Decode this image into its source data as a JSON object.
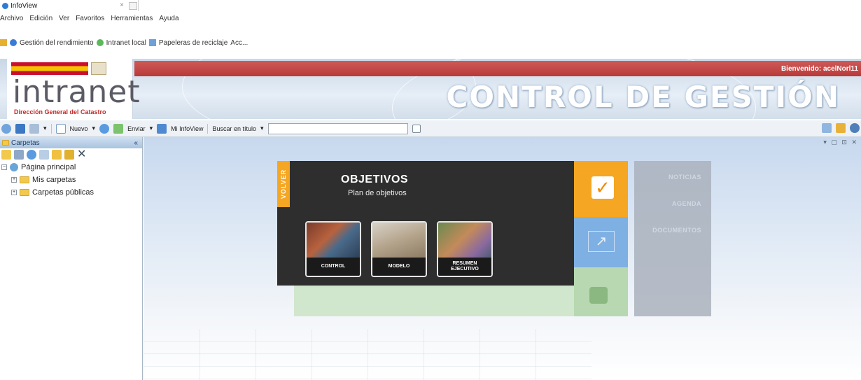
{
  "browser": {
    "tab_title": "InfoView",
    "tab_close": "×",
    "menu": [
      "Archivo",
      "Edición",
      "Ver",
      "Favoritos",
      "Herramientas",
      "Ayuda"
    ],
    "favorites": [
      "Gestión del rendimiento",
      "Intranet local",
      "Papeleras de reciclaje",
      "Acc..."
    ]
  },
  "banner": {
    "welcome": "Bienvenido: acelNorl11",
    "logo_word": "intranet",
    "logo_sub": "Dirección General del Catastro",
    "title": "CONTROL DE GESTIÓN"
  },
  "toolbar": {
    "new_label": "Nuevo",
    "send_label": "Enviar",
    "myinfoview_label": "Mi InfoView",
    "search_label": "Buscar en título",
    "search_value": ""
  },
  "left_pane": {
    "header": "Carpetas",
    "collapse": "«",
    "tree": {
      "root": "Página principal",
      "children": [
        "Mis carpetas",
        "Carpetas públicas"
      ]
    }
  },
  "main": {
    "window_controls": "▾ ▢ ⊡ ✕",
    "volver": "VOLVER",
    "objetivos_title": "OBJETIVOS",
    "objetivos_subtitle": "Plan de objetivos",
    "cards": [
      "CONTROL",
      "MODELO",
      "RESUMEN EJECUTIVO"
    ],
    "side_menu": [
      "NOTICIAS",
      "AGENDA",
      "DOCUMENTOS"
    ],
    "check_glyph": "✓",
    "chart_glyph": "↗"
  },
  "colors": {
    "accent_orange": "#f5a623",
    "banner_red": "#b83a3a",
    "overlay_dark": "#2e2e2e"
  }
}
